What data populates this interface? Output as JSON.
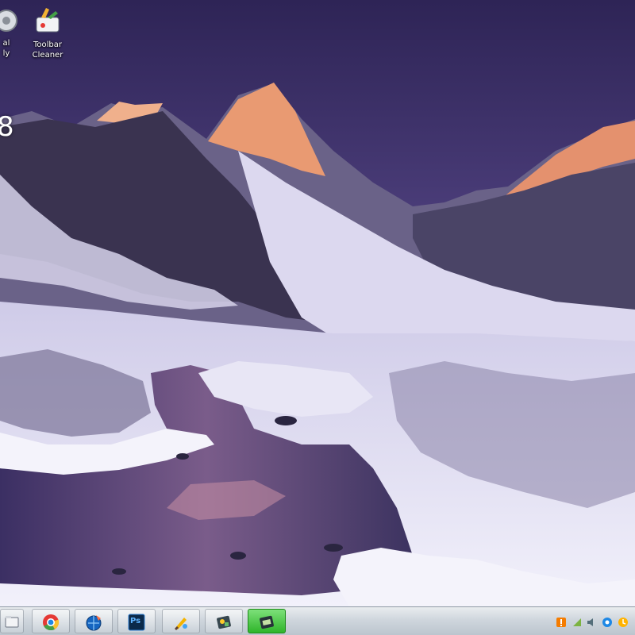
{
  "desktop": {
    "icons": [
      {
        "label_line1": "al",
        "label_line2": "ly",
        "icon": "gear-app-icon"
      },
      {
        "label_line1": "Toolbar",
        "label_line2": "Cleaner",
        "icon": "toolbar-cleaner-icon"
      }
    ],
    "gadget_text": "8",
    "wallpaper": "snowy-mountain-valley-with-stream-at-dusk"
  },
  "taskbar": {
    "buttons": [
      {
        "icon": "windows-explorer-icon",
        "active": false
      },
      {
        "icon": "chrome-icon",
        "active": false
      },
      {
        "icon": "globe-tool-icon",
        "active": false
      },
      {
        "icon": "photoshop-icon",
        "label": "Ps",
        "active": false
      },
      {
        "icon": "paint-brush-icon",
        "active": false
      },
      {
        "icon": "image-tool-icon",
        "active": false
      },
      {
        "icon": "green-app-icon",
        "active": true
      }
    ],
    "tray_icons": [
      "warning-icon",
      "network-icon",
      "volume-icon",
      "security-icon",
      "update-icon"
    ]
  },
  "colors": {
    "sky_top": "#3a2c63",
    "sky_glow": "#b46a8a",
    "peak_lit": "#f0a37a",
    "snow": "#e9e7f4",
    "stream": "#5b4a82",
    "taskbar": "#cfd6dd",
    "active_button": "#2fb52a"
  }
}
